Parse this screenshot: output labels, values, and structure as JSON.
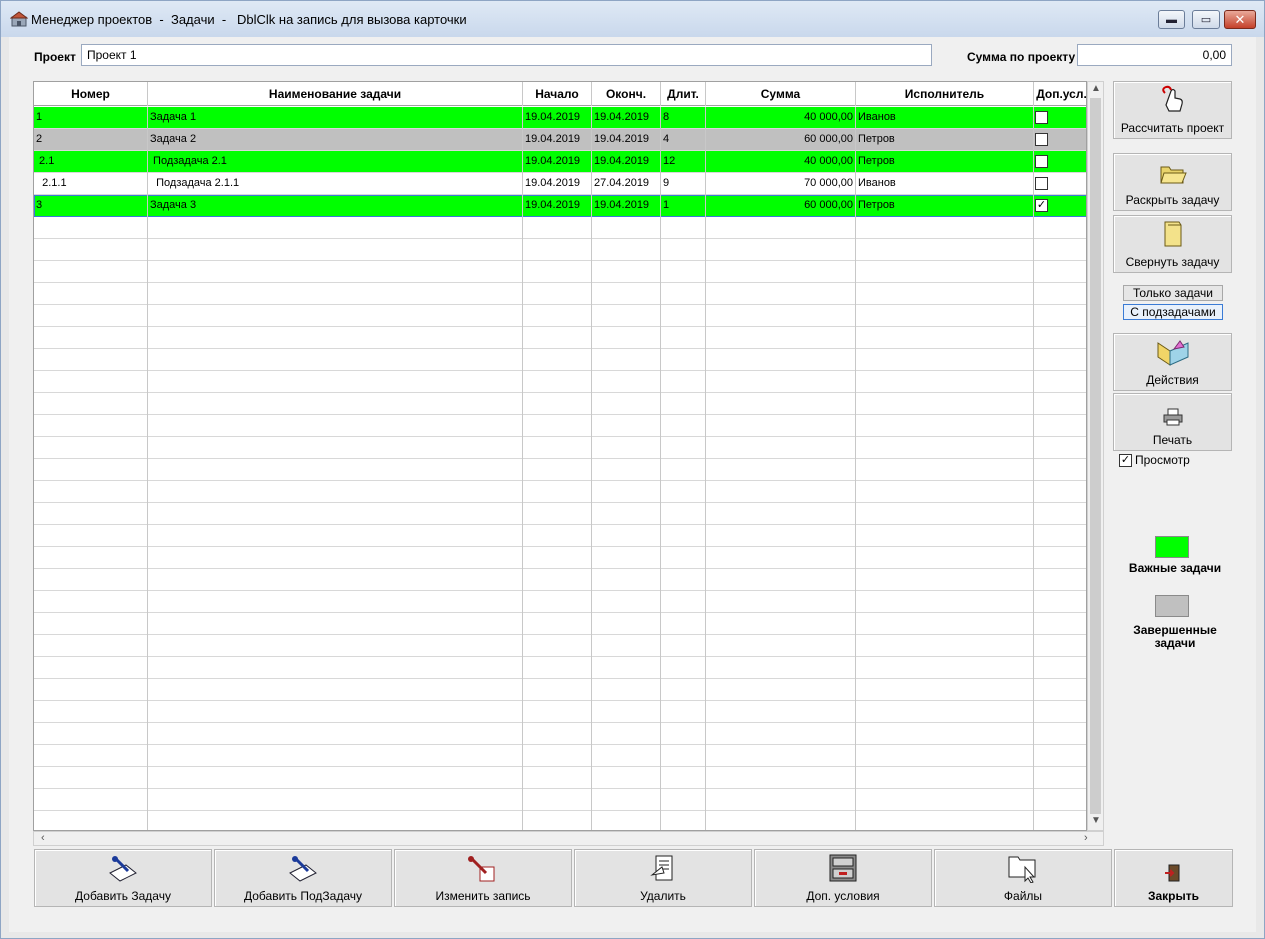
{
  "window": {
    "title": "Менеджер проектов  -  Задачи  -   DblClk на запись для вызова карточки",
    "minimize_glyph": "▬",
    "maximize_glyph": "▭",
    "close_glyph": "✕"
  },
  "project": {
    "label": "Проект",
    "value": "Проект 1",
    "sum_label": "Сумма по проекту",
    "sum_value": "0,00"
  },
  "grid": {
    "columns": [
      "Номер",
      "Наименование задачи",
      "Начало",
      "Оконч.",
      "Длит.",
      "Сумма",
      "Исполнитель",
      "Доп.усл."
    ],
    "rows": [
      {
        "num": "1",
        "name": "Задача 1",
        "start": "19.04.2019",
        "end": "19.04.2019",
        "dur": "8",
        "sum": "40 000,00",
        "exec": "Иванов",
        "extra": false,
        "status": "important"
      },
      {
        "num": "2",
        "name": "Задача 2",
        "start": "19.04.2019",
        "end": "19.04.2019",
        "dur": "4",
        "sum": "60 000,00",
        "exec": "Петров",
        "extra": false,
        "status": "completed"
      },
      {
        "num": " 2.1",
        "name": " Подзадача 2.1",
        "start": "19.04.2019",
        "end": "19.04.2019",
        "dur": "12",
        "sum": "40 000,00",
        "exec": "Петров",
        "extra": false,
        "status": "important"
      },
      {
        "num": "  2.1.1",
        "name": "  Подзадача 2.1.1",
        "start": "19.04.2019",
        "end": "27.04.2019",
        "dur": "9",
        "sum": "70 000,00",
        "exec": "Иванов",
        "extra": false,
        "status": "normal"
      },
      {
        "num": "3",
        "name": "Задача 3",
        "start": "19.04.2019",
        "end": "19.04.2019",
        "dur": "1",
        "sum": "60 000,00",
        "exec": "Петров",
        "extra": true,
        "status": "important"
      }
    ],
    "empty_rows": 28
  },
  "side": {
    "calc_label": "Рассчитать проект",
    "expand_label": "Раскрыть задачу",
    "collapse_label": "Свернуть задачу",
    "only_tasks_label": "Только задачи",
    "with_subtasks_label": "С подзадачами",
    "actions_label": "Действия",
    "print_label": "Печать",
    "preview_label": "Просмотр",
    "preview_checked": true,
    "legend_important": "Важные задачи",
    "legend_completed": "Завершенные задачи"
  },
  "toolbar": {
    "add_task": "Добавить Задачу",
    "add_subtask": "Добавить ПодЗадачу",
    "edit": "Изменить запись",
    "delete": "Удалить",
    "extra": "Доп. условия",
    "files": "Файлы",
    "close": "Закрыть"
  },
  "colors": {
    "important": "#00ff00",
    "completed": "#c0c0c0",
    "normal": "#ffffff",
    "selected_border": "#3a7bd5"
  }
}
